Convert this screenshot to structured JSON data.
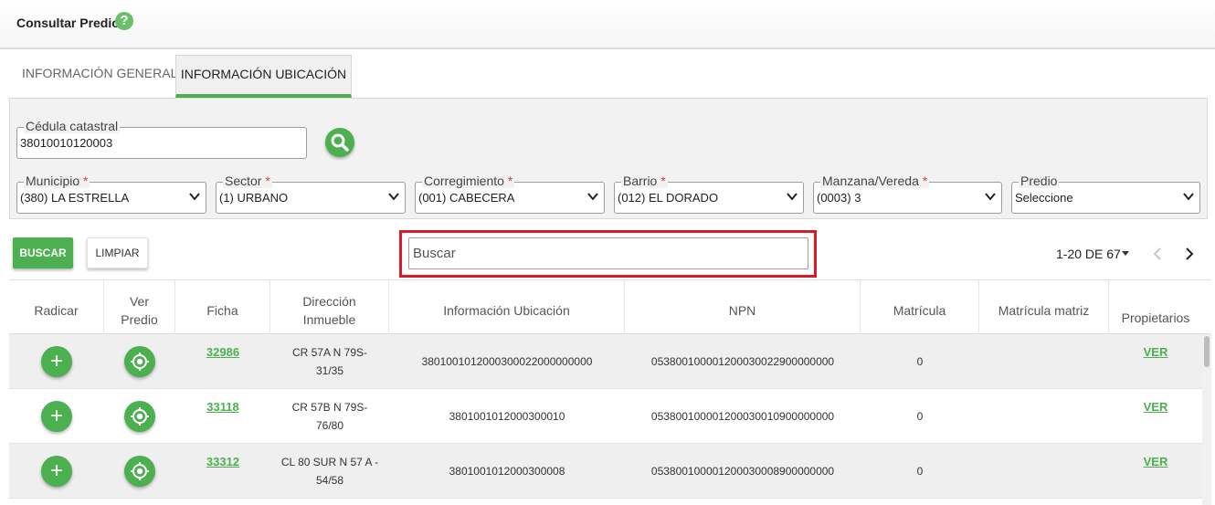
{
  "header": {
    "title": "Consultar Predio",
    "help_icon": "?"
  },
  "tabs": [
    {
      "label": "INFORMACIÓN GENERAL",
      "active": false
    },
    {
      "label": "INFORMACIÓN UBICACIÓN",
      "active": true
    }
  ],
  "filters": {
    "cedula": {
      "label": "Cédula catastral",
      "value": "38010010120003"
    },
    "municipio": {
      "label": "Municipio",
      "required": "*",
      "value": "(380) LA ESTRELLA"
    },
    "sector": {
      "label": "Sector",
      "required": "*",
      "value": "(1) URBANO"
    },
    "corregimiento": {
      "label": "Corregimiento",
      "required": "*",
      "value": "(001) CABECERA"
    },
    "barrio": {
      "label": "Barrio",
      "required": "*",
      "value": "(012) EL DORADO"
    },
    "manzana": {
      "label": "Manzana/Vereda",
      "required": "*",
      "value": "(0003) 3"
    },
    "predio": {
      "label": "Predio",
      "value": "Seleccione"
    }
  },
  "actions": {
    "buscar_label": "BUSCAR",
    "limpiar_label": "LIMPIAR",
    "search_placeholder": "Buscar"
  },
  "pager": {
    "range": "1-20 DE 67"
  },
  "table": {
    "headers": {
      "radicar": "Radicar",
      "ver_predio_1": "Ver",
      "ver_predio_2": "Predio",
      "ficha": "Ficha",
      "direccion_1": "Dirección",
      "direccion_2": "Inmueble",
      "info_ubicacion": "Información Ubicación",
      "npn": "NPN",
      "matricula": "Matrícula",
      "matricula_matriz": "Matrícula matriz",
      "propietarios": "Propietarios"
    },
    "rows": [
      {
        "ficha": "32986",
        "dir_1": "CR 57A N 79S-",
        "dir_2": "31/35",
        "info": "3801001012000300022000000000",
        "npn": "053800100001200030022900000000",
        "matricula": "0",
        "matricula_matriz": "",
        "propietarios": "VER"
      },
      {
        "ficha": "33118",
        "dir_1": "CR 57B N 79S-",
        "dir_2": "76/80",
        "info": "3801001012000300010",
        "npn": "053800100001200030010900000000",
        "matricula": "0",
        "matricula_matriz": "",
        "propietarios": "VER"
      },
      {
        "ficha": "33312",
        "dir_1": "CL 80 SUR N 57 A -",
        "dir_2": "54/58",
        "info": "3801001012000300008",
        "npn": "053800100001200030008900000000",
        "matricula": "0",
        "matricula_matriz": "",
        "propietarios": "VER"
      }
    ]
  },
  "colors": {
    "accent": "#4caf50",
    "highlight": "#d81b28",
    "required": "#e53935"
  },
  "icons": {
    "add": "plus-icon",
    "locate": "target-icon",
    "search": "search-icon"
  }
}
